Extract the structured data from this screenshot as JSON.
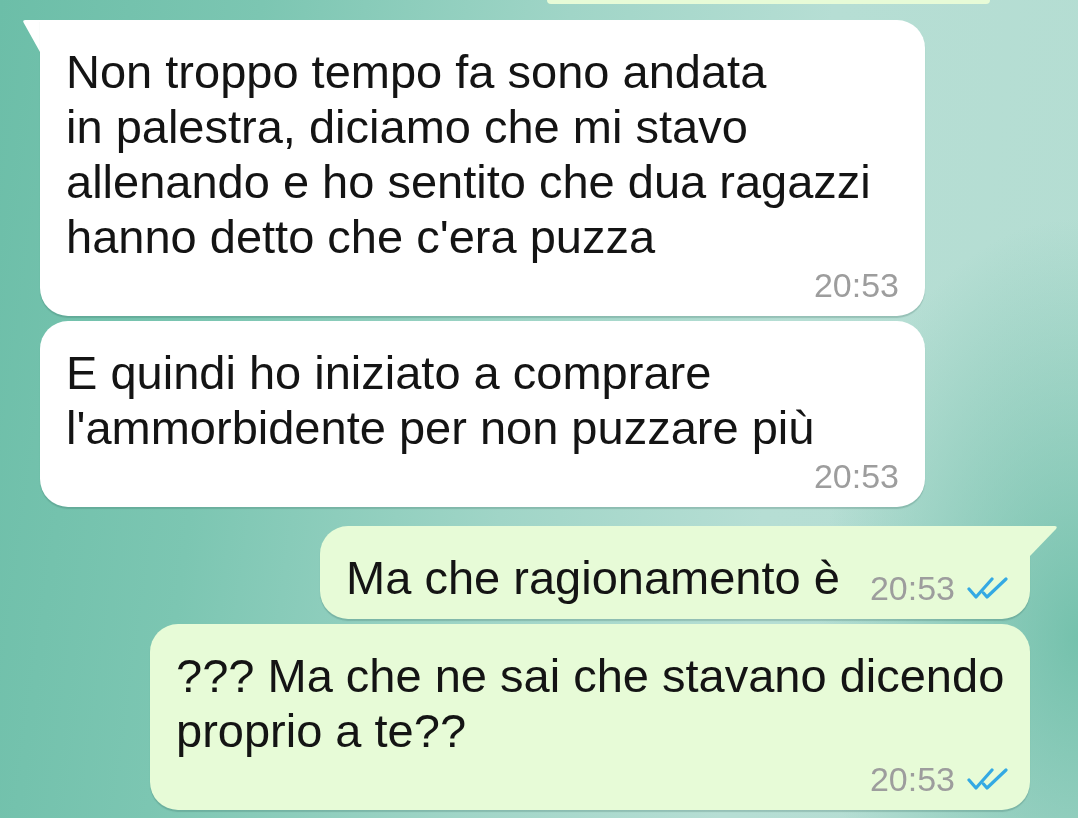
{
  "messages": [
    {
      "kind": "incoming",
      "text": "Non troppo tempo fa sono andata\nin palestra, diciamo che mi stavo\nallenando e ho sentito che dua ragazzi\nhanno detto che c'era puzza",
      "time": "20:53"
    },
    {
      "kind": "incoming",
      "text": "E quindi ho iniziato a comprare\nl'ammorbidente per non puzzare più",
      "time": "20:53"
    },
    {
      "kind": "outgoing",
      "text": "Ma che ragionamento è",
      "time": "20:53",
      "read": true
    },
    {
      "kind": "outgoing",
      "text": "??? Ma che ne sai che stavano dicendo\nproprio a te??",
      "time": "20:53",
      "read": true
    }
  ]
}
